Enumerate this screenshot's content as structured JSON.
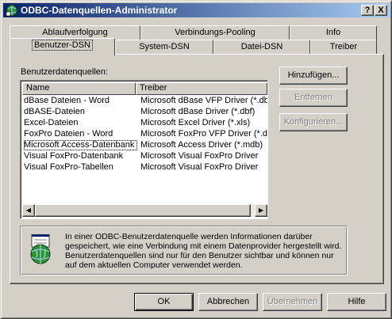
{
  "window": {
    "title": "ODBC-Datenquellen-Administrator",
    "help_button": "?",
    "close_button": "X",
    "title_gradient": [
      "#0a246a",
      "#a6caf0"
    ]
  },
  "tabs_back_row": [
    "Ablaufverfolgung",
    "Verbindungs-Pooling",
    "Info"
  ],
  "tabs_front_row": [
    "Benutzer-DSN",
    "System-DSN",
    "Datei-DSN",
    "Treiber"
  ],
  "active_tab": "Benutzer-DSN",
  "panel": {
    "list_label": "Benutzerdatenquellen:",
    "columns": [
      "Name",
      "Treiber"
    ],
    "rows": [
      {
        "name": "dBase Dateien - Word",
        "driver": "Microsoft dBase VFP Driver (*.dbf)"
      },
      {
        "name": "dBASE-Dateien",
        "driver": "Microsoft dBase Driver (*.dbf)"
      },
      {
        "name": "Excel-Dateien",
        "driver": "Microsoft Excel Driver (*.xls)"
      },
      {
        "name": "FoxPro Dateien - Word",
        "driver": "Microsoft FoxPro VFP Driver (*.dbf)"
      },
      {
        "name": "Microsoft Access-Datenbank",
        "driver": "Microsoft Access Driver (*.mdb)"
      },
      {
        "name": "Visual FoxPro-Datenbank",
        "driver": "Microsoft Visual FoxPro Driver"
      },
      {
        "name": "Visual FoxPro-Tabellen",
        "driver": "Microsoft Visual FoxPro Driver"
      }
    ],
    "focused_row": "Microsoft Access-Datenbank",
    "buttons": {
      "add": "Hinzufügen...",
      "remove": "Entfernen",
      "configure": "Konfigurieren..."
    },
    "info_text": "In einer ODBC-Benutzerdatenquelle werden Informationen darüber gespeichert, wie eine Verbindung mit einem Datenprovider hergestellt wird. Benutzerdatenquellen sind nur für den Benutzer sichtbar und können nur auf dem aktuellen Computer verwendet werden."
  },
  "footer": {
    "ok": "OK",
    "cancel": "Abbrechen",
    "apply": "Übernehmen",
    "help": "Hilfe"
  }
}
